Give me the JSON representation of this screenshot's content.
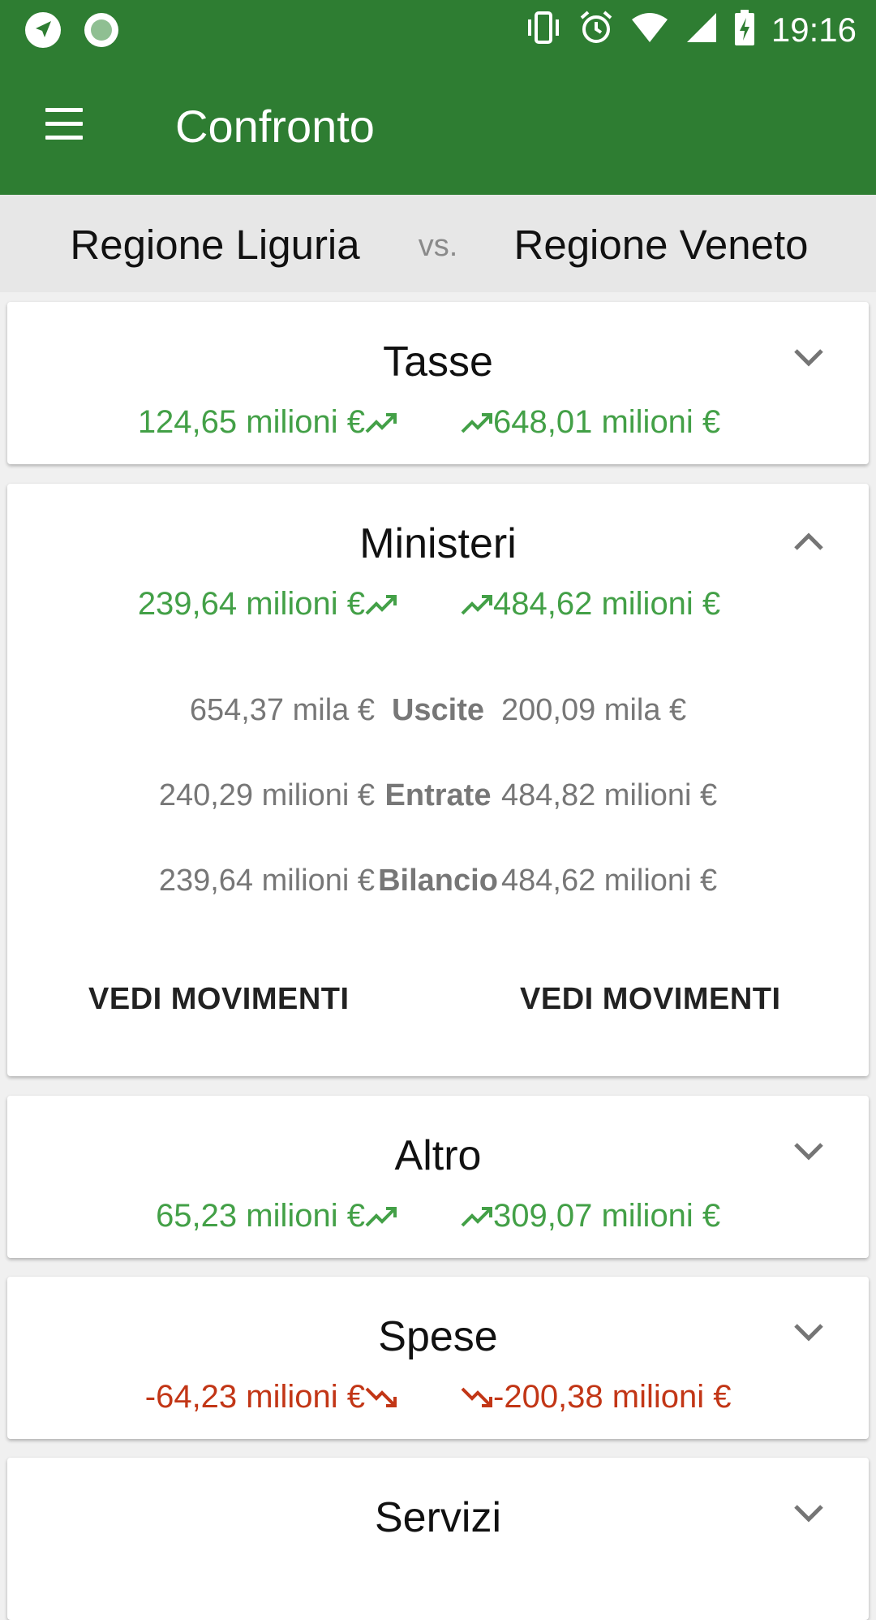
{
  "status_bar": {
    "time": "19:16",
    "left_icons": [
      "navigation-icon",
      "record-icon"
    ],
    "right_icons": [
      "vibrate-icon",
      "alarm-icon",
      "wifi-icon",
      "signal-icon",
      "battery-charging-icon"
    ]
  },
  "toolbar": {
    "title": "Confronto",
    "menu_icon": "menu-icon"
  },
  "comparison": {
    "left_entity": "Regione Liguria",
    "separator": "vs.",
    "right_entity": "Regione Veneto"
  },
  "categories": [
    {
      "title": "Tasse",
      "left_value": "124,65 milioni €",
      "right_value": "648,01 milioni €",
      "trend": "up",
      "expanded": false
    },
    {
      "title": "Ministeri",
      "left_value": "239,64 milioni €",
      "right_value": "484,62 milioni €",
      "trend": "up",
      "expanded": true,
      "details": [
        {
          "label": "Uscite",
          "left": "654,37 mila €",
          "right": "200,09 mila €"
        },
        {
          "label": "Entrate",
          "left": "240,29 milioni €",
          "right": "484,82 milioni €"
        },
        {
          "label": "Bilancio",
          "left": "239,64 milioni €",
          "right": "484,62 milioni €"
        }
      ],
      "left_button": "VEDI MOVIMENTI",
      "right_button": "VEDI MOVIMENTI"
    },
    {
      "title": "Altro",
      "left_value": "65,23 milioni €",
      "right_value": "309,07 milioni €",
      "trend": "up",
      "expanded": false
    },
    {
      "title": "Spese",
      "left_value": "-64,23 milioni €",
      "right_value": "-200,38 milioni €",
      "trend": "down",
      "expanded": false
    },
    {
      "title": "Servizi",
      "expanded": false
    }
  ],
  "colors": {
    "primary": "#2e7d32",
    "positive": "#43a047",
    "negative": "#c23616",
    "vs_bar_bg": "#e7e7e7"
  }
}
